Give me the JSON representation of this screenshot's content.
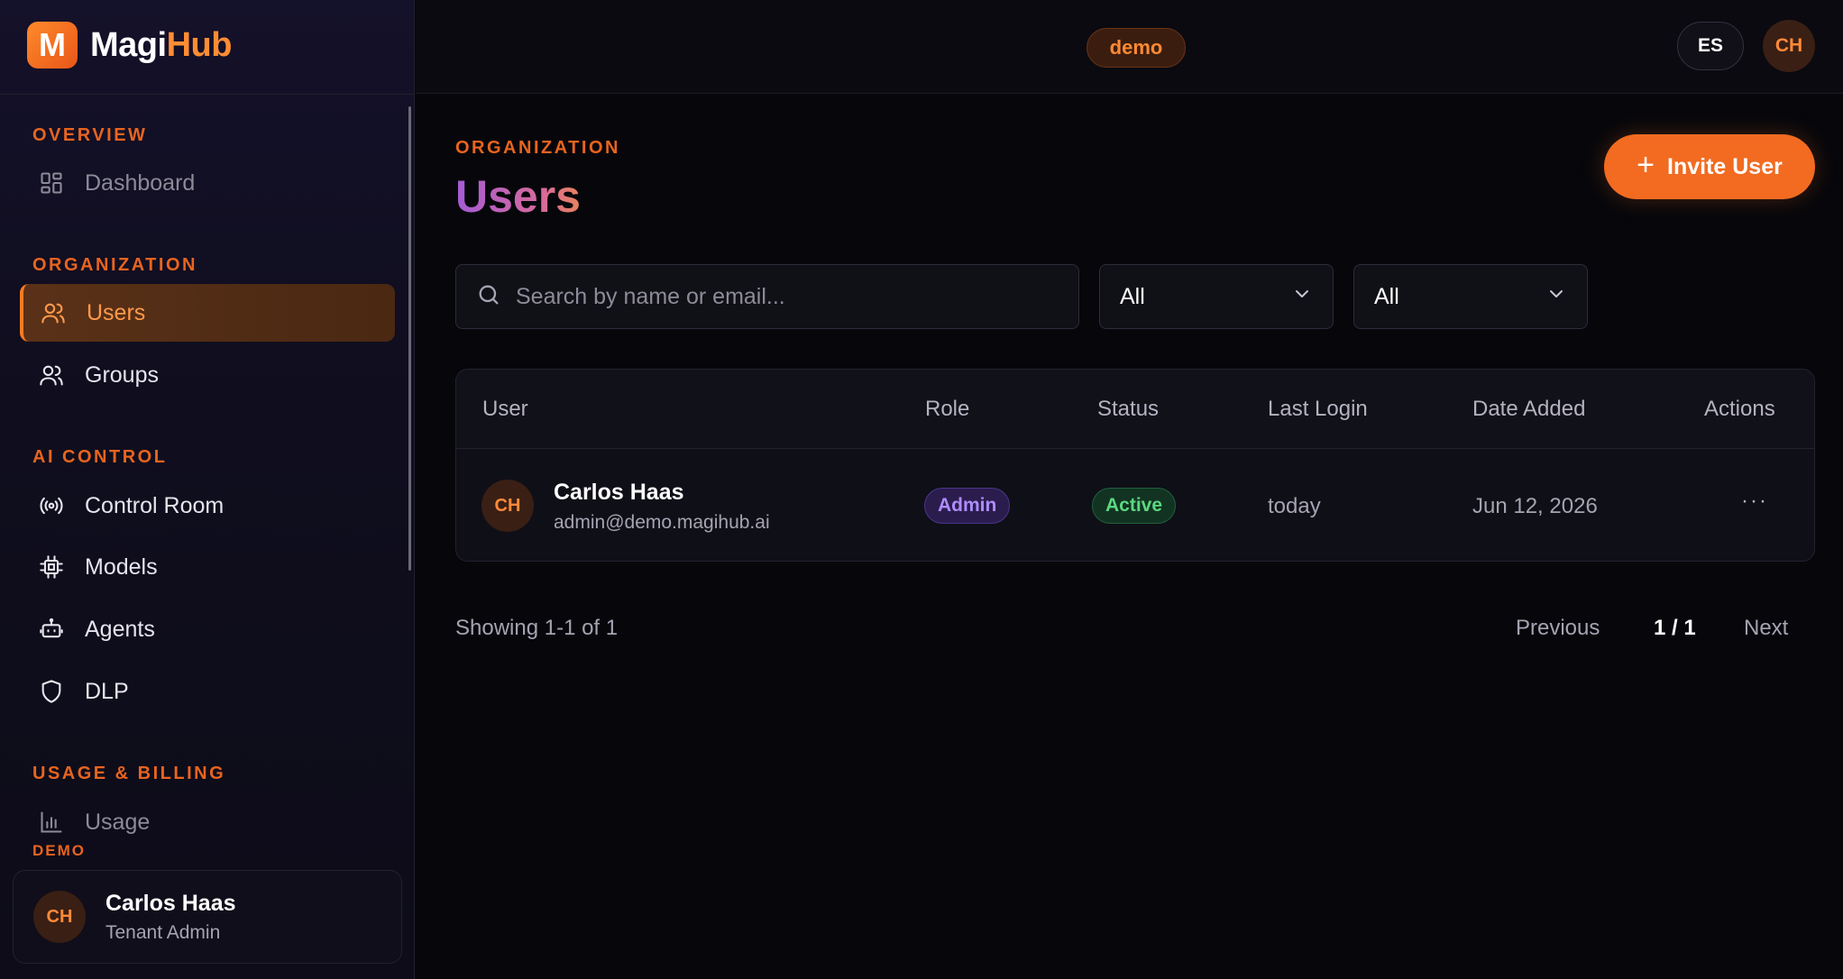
{
  "app": {
    "brand_letter": "M",
    "brand_part1": "Magi",
    "brand_part2": "Hub"
  },
  "topbar": {
    "tenant": "demo",
    "language": "ES",
    "avatar_initials": "CH"
  },
  "sidebar": {
    "sections": {
      "overview": "OVERVIEW",
      "organization": "ORGANIZATION",
      "ai_control": "AI CONTROL",
      "usage_billing": "USAGE & BILLING"
    },
    "items": [
      {
        "label": "Dashboard",
        "icon": "dashboard-icon"
      },
      {
        "label": "Users",
        "icon": "users-icon",
        "active": true
      },
      {
        "label": "Groups",
        "icon": "groups-icon"
      },
      {
        "label": "Control Room",
        "icon": "broadcast-icon"
      },
      {
        "label": "Models",
        "icon": "chip-icon"
      },
      {
        "label": "Agents",
        "icon": "bot-icon"
      },
      {
        "label": "DLP",
        "icon": "shield-icon"
      },
      {
        "label": "Usage",
        "icon": "bar-chart-icon"
      }
    ],
    "tenant_label": "DEMO",
    "user": {
      "initials": "CH",
      "name": "Carlos Haas",
      "role": "Tenant Admin"
    }
  },
  "main": {
    "eyebrow": "ORGANIZATION",
    "title": "Users",
    "invite_label": "Invite User",
    "search": {
      "placeholder": "Search by name or email...",
      "value": ""
    },
    "filters": [
      {
        "value": "All"
      },
      {
        "value": "All"
      }
    ],
    "table": {
      "columns": [
        "User",
        "Role",
        "Status",
        "Last Login",
        "Date Added",
        "Actions"
      ],
      "rows": [
        {
          "initials": "CH",
          "name": "Carlos Haas",
          "email": "admin@demo.magihub.ai",
          "role": "Admin",
          "status": "Active",
          "last_login": "today",
          "date_added": "Jun 12, 2026",
          "actions": "···"
        }
      ]
    },
    "pagination": {
      "showing": "Showing 1-1 of 1",
      "previous": "Previous",
      "page": "1 / 1",
      "next": "Next"
    }
  },
  "colors": {
    "accent": "#f26b21",
    "background": "#07070b",
    "sidebar": "#100e1f",
    "role_badge": "#b08cff",
    "status_badge": "#5bd87f"
  }
}
